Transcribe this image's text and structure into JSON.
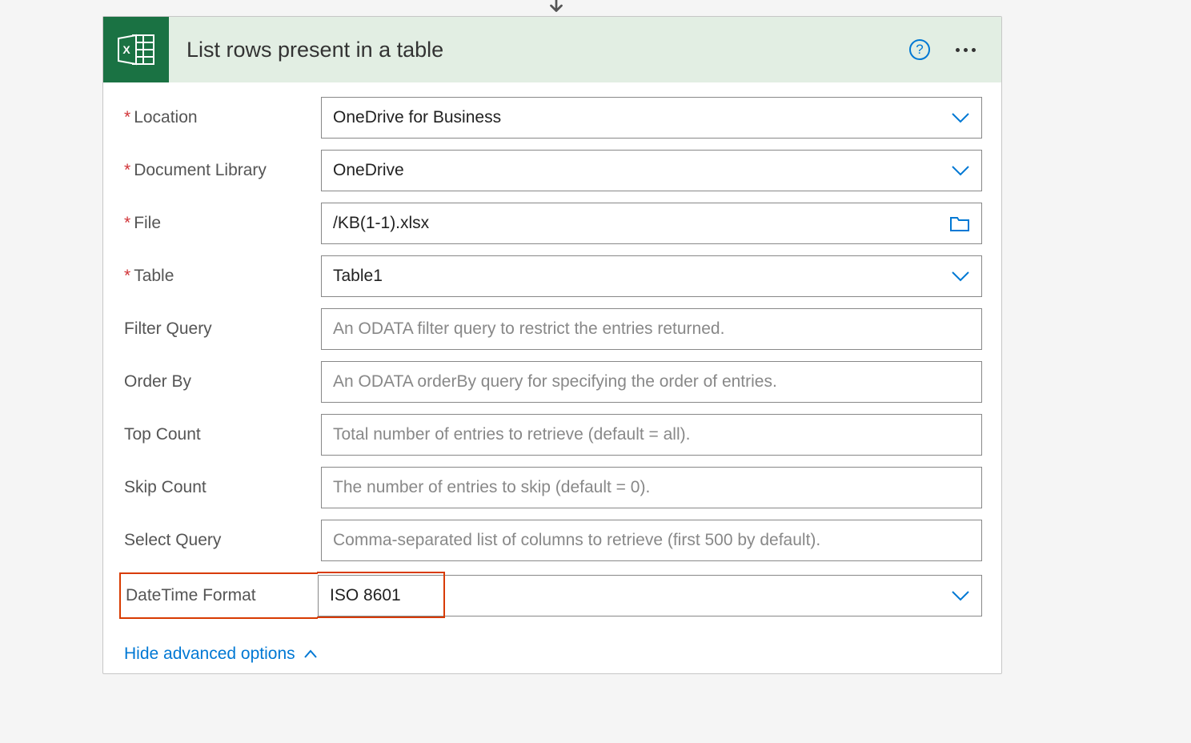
{
  "header": {
    "title": "List rows present in a table",
    "help_label": "?"
  },
  "fields": {
    "location": {
      "label": "Location",
      "value": "OneDrive for Business",
      "required": true
    },
    "document_library": {
      "label": "Document Library",
      "value": "OneDrive",
      "required": true
    },
    "file": {
      "label": "File",
      "value": "/KB(1-1).xlsx",
      "required": true
    },
    "table": {
      "label": "Table",
      "value": "Table1",
      "required": true
    },
    "filter_query": {
      "label": "Filter Query",
      "placeholder": "An ODATA filter query to restrict the entries returned."
    },
    "order_by": {
      "label": "Order By",
      "placeholder": "An ODATA orderBy query for specifying the order of entries."
    },
    "top_count": {
      "label": "Top Count",
      "placeholder": "Total number of entries to retrieve (default = all)."
    },
    "skip_count": {
      "label": "Skip Count",
      "placeholder": "The number of entries to skip (default = 0)."
    },
    "select_query": {
      "label": "Select Query",
      "placeholder": "Comma-separated list of columns to retrieve (first 500 by default)."
    },
    "datetime_format": {
      "label": "DateTime Format",
      "value": "ISO 8601"
    }
  },
  "advanced_toggle": "Hide advanced options"
}
